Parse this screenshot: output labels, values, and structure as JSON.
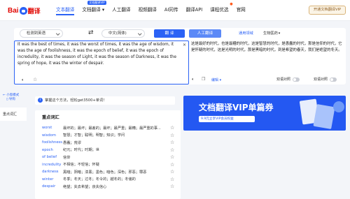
{
  "header": {
    "logo_bai": "Bai",
    "logo_fy": "翻译",
    "nav": [
      {
        "label": "文本翻译",
        "active": true
      },
      {
        "label": "文档翻译",
        "badge": "文档翻译VIP",
        "dropdown": true
      },
      {
        "label": "人工翻译"
      },
      {
        "label": "视频翻译"
      },
      {
        "label": "AI同传"
      },
      {
        "label": "翻译API"
      },
      {
        "label": "课程优选",
        "hot": true
      },
      {
        "label": "官网"
      }
    ],
    "vip_button": "开通文档翻译VIP"
  },
  "sidebar": {
    "link_a": "← 小窗模式",
    "link_b": "▯ 导购",
    "section": "重点词汇"
  },
  "translator": {
    "source_lang": "检测到英语",
    "swap_icon": "swap-icon",
    "target_lang": "中文(简体)",
    "translate_label": "翻  译",
    "human_label": "人工翻译",
    "domain_label": "通用领域",
    "domain_value": "生物医药",
    "source_text": "It was the best of times, it was the worst of times, it was the age of wisdom, it was the age of foolishness, it was the epoch of belief, it was the epoch of incredulity, it was the season of Light, it was the season of Darkness, it was the spring of hope, it was the winter of despair.",
    "target_text": "这是最好的时代，也是最糟的时代，这是智慧的时代，是愚蠢的时代，那是信仰的时代，它是怀疑的时代，这是光明的时代，那是黑暗的时代，到是希望的春天，我们是绝望的冬天。",
    "edit_label": "编辑",
    "sync_label": "双语对照",
    "compare_label": "双语对照"
  },
  "tip": {
    "text": "掌握这个方法，轻松get3500+单词！"
  },
  "vocab": {
    "title": "重点词汇",
    "rows": [
      {
        "word": "worst",
        "meaning": "最坏的；最坏；最差的；最坏；最严重；最糟；最严重的事..."
      },
      {
        "word": "wisdom",
        "meaning": "智慧；才智；聪明；明智；知识；学问"
      },
      {
        "word": "foolishness",
        "meaning": "愚蠢；荒谬"
      },
      {
        "word": "epoch",
        "meaning": "纪元；时代；时期；世"
      },
      {
        "word": "of belief",
        "meaning": "信仰"
      },
      {
        "word": "incredulity",
        "meaning": "不相信；不轻信；怀疑"
      },
      {
        "word": "darkness",
        "meaning": "黑暗；阴暗；漆黑；墨色；暗色；深色；邪恶；罪恶"
      },
      {
        "word": "winter",
        "meaning": "冬季；冬天；过冬；冬令的；越冬的；冬储的"
      },
      {
        "word": "despair",
        "meaning": "绝望；失去希望；丧失信心"
      }
    ]
  },
  "banner": {
    "title": "文档翻译VIP单篇券",
    "sub": "9.9元立享VIP会员权益"
  }
}
